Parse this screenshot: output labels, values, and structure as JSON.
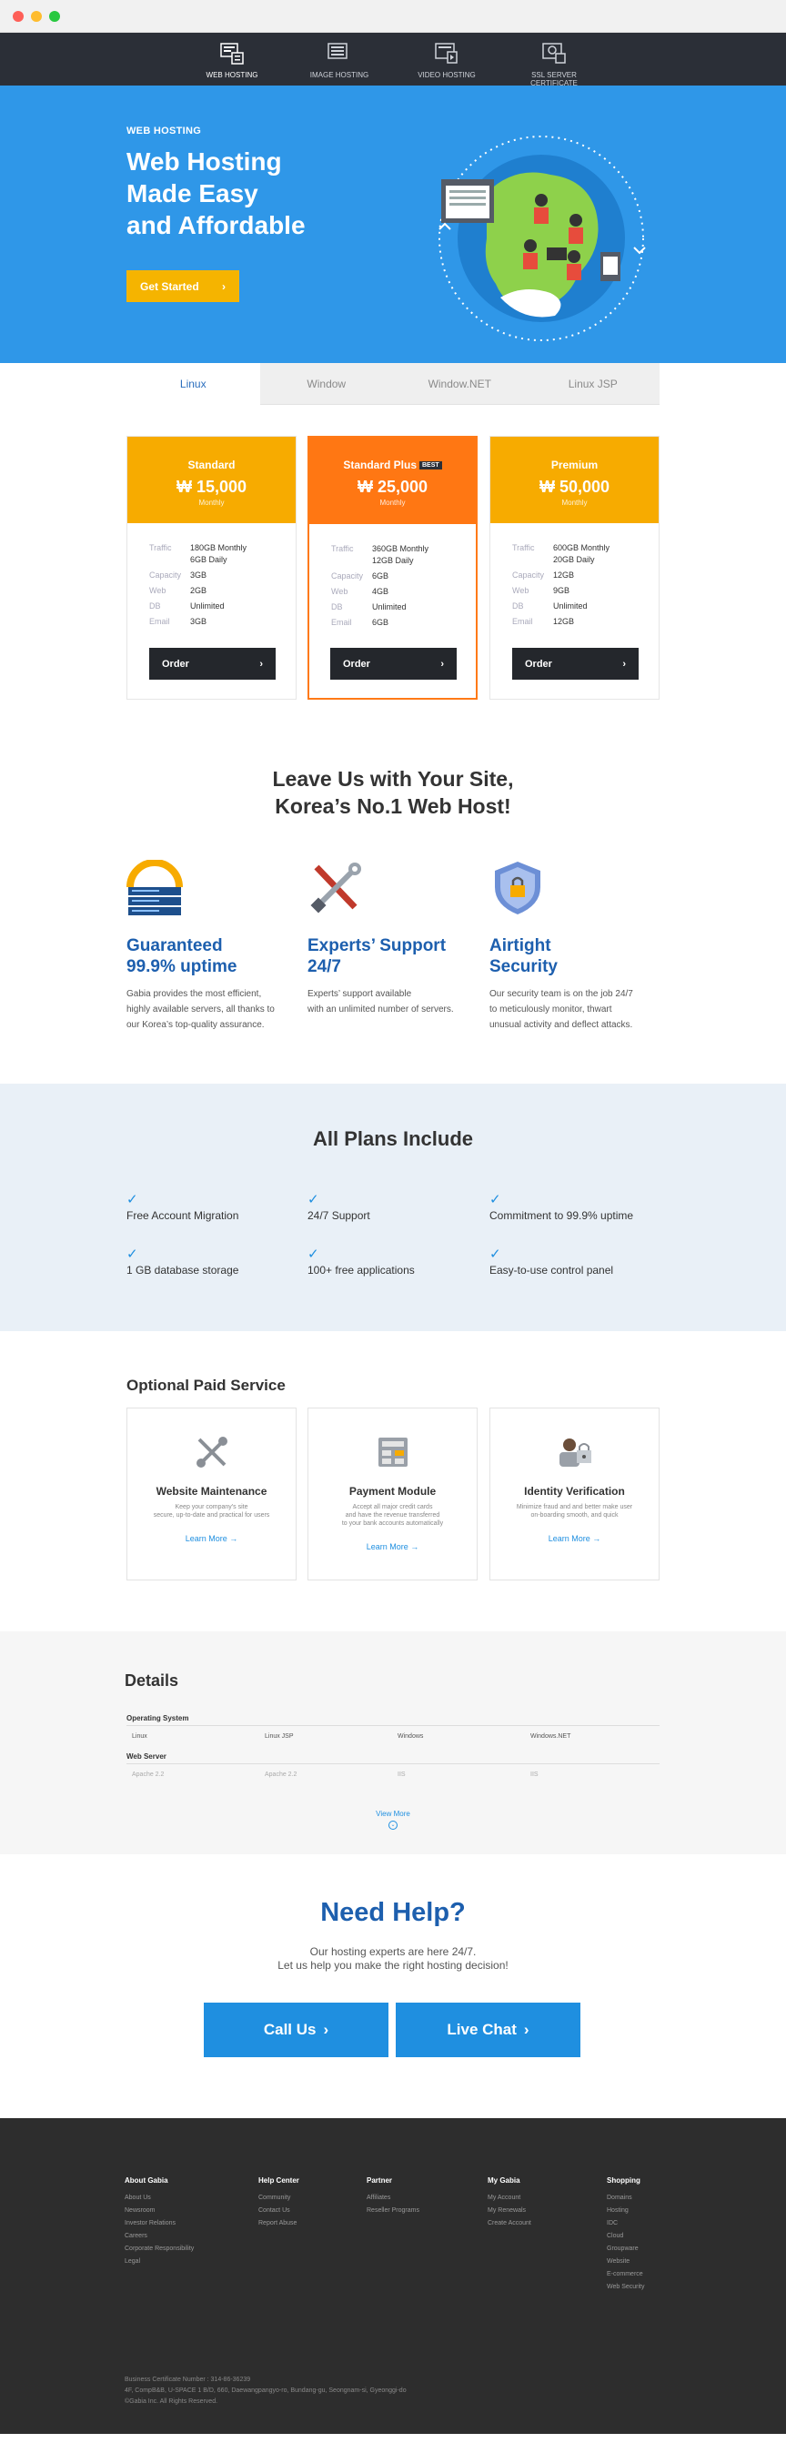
{
  "topnav": {
    "items": [
      {
        "label": "WEB HOSTING",
        "icon": "web-hosting-icon",
        "active": true
      },
      {
        "label": "IMAGE HOSTING",
        "icon": "image-hosting-icon",
        "active": false
      },
      {
        "label": "VIDEO HOSTING",
        "icon": "video-hosting-icon",
        "active": false
      },
      {
        "label": "SSL SERVER CERTIFICATE",
        "icon": "ssl-certificate-icon",
        "active": false
      }
    ]
  },
  "hero": {
    "eyebrow": "WEB HOSTING",
    "title": "Web Hosting\nMade Easy\nand Affordable",
    "cta": "Get Started"
  },
  "tabs": [
    "Linux",
    "Window",
    "Window.NET",
    "Linux JSP"
  ],
  "plans": [
    {
      "name": "Standard",
      "price": "₩ 15,000",
      "cycle": "Monthly",
      "color": "#f7ab00",
      "badge": "",
      "specs": [
        [
          "Traffic",
          "180GB Monthly\n6GB Daily"
        ],
        [
          "Capacity",
          "3GB"
        ],
        [
          "Web",
          "2GB"
        ],
        [
          "DB",
          "Unlimited"
        ],
        [
          "Email",
          "3GB"
        ]
      ],
      "order": "Order"
    },
    {
      "name": "Standard Plus",
      "price": "₩ 25,000",
      "cycle": "Monthly",
      "color": "#ff7713",
      "badge": "BEST",
      "specs": [
        [
          "Traffic",
          "360GB Monthly\n12GB Daily"
        ],
        [
          "Capacity",
          "6GB"
        ],
        [
          "Web",
          "4GB"
        ],
        [
          "DB",
          "Unlimited"
        ],
        [
          "Email",
          "6GB"
        ]
      ],
      "order": "Order"
    },
    {
      "name": "Premium",
      "price": "₩ 50,000",
      "cycle": "Monthly",
      "color": "#f7ab00",
      "badge": "",
      "specs": [
        [
          "Traffic",
          "600GB Monthly\n20GB Daily"
        ],
        [
          "Capacity",
          "12GB"
        ],
        [
          "Web",
          "9GB"
        ],
        [
          "DB",
          "Unlimited"
        ],
        [
          "Email",
          "12GB"
        ]
      ],
      "order": "Order"
    }
  ],
  "leave": "Leave Us with Your Site,\nKorea’s No.1 Web Host!",
  "features": [
    {
      "title": "Guaranteed\n99.9% uptime",
      "text": "Gabia provides the most efficient,\nhighly available servers, all thanks to\nour Korea’s top-quality assurance.",
      "icon": "uptime-server-icon",
      "badge": "99.9%"
    },
    {
      "title": "Experts’ Support\n24/7",
      "text": "Experts’ support available\nwith an unlimited number of servers.",
      "icon": "tools-icon"
    },
    {
      "title": "Airtight\nSecurity",
      "text": "Our security team is on the job 24/7\nto meticulously monitor, thwart\nunusual activity and deflect attacks.",
      "icon": "security-shield-icon"
    }
  ],
  "allplans": {
    "title": "All Plans Include",
    "items": [
      "Free Account Migration",
      "24/7 Support",
      "Commitment to 99.9% uptime",
      "1 GB database storage",
      "100+ free applications",
      "Easy-to-use control panel"
    ]
  },
  "optional": {
    "title": "Optional Paid Service",
    "cards": [
      {
        "name": "Website Maintenance",
        "desc": "Keep your company’s site\nsecure, up-to-date and practical for users",
        "more": "Learn More",
        "icon": "wrench-icon"
      },
      {
        "name": "Payment Module",
        "desc": "Accept all major credit cards\nand have the revenue transferred\nto your bank accounts automatically",
        "more": "Learn More",
        "icon": "calculator-icon"
      },
      {
        "name": "Identity Verification",
        "desc": "Minimize fraud and and better make user\non-boarding smooth, and quick",
        "more": "Learn More",
        "icon": "identity-lock-icon"
      }
    ]
  },
  "details": {
    "title": "Details",
    "os_label": "Operating System",
    "os": [
      "Linux",
      "Linux JSP",
      "Windows",
      "Windows.NET"
    ],
    "ws_label": "Web Server",
    "ws": [
      "Apache 2.2",
      "Apache 2.2",
      "IIS",
      "IIS"
    ],
    "more": "View More"
  },
  "help": {
    "title": "Need Help?",
    "sub": "Our hosting experts are here 24/7.\nLet us help you make the right hosting decision!",
    "call": "Call Us",
    "chat": "Live Chat"
  },
  "footer": {
    "cols": [
      {
        "head": "About Gabia",
        "items": [
          "About Us",
          "Newsroom",
          "Investor Relations",
          "Careers",
          "Corporate Responsibility",
          "Legal"
        ]
      },
      {
        "head": "Help Center",
        "items": [
          "Community",
          "Contact Us",
          "Report Abuse"
        ]
      },
      {
        "head": "Partner",
        "items": [
          "Affiliates",
          "Reseller Programs"
        ]
      },
      {
        "head": "My Gabia",
        "items": [
          "My Account",
          "My Renewals",
          "Create Account"
        ]
      },
      {
        "head": "Shopping",
        "items": [
          "Domains",
          "Hosting",
          "IDC",
          "Cloud",
          "Groupware",
          "Website",
          "E-commerce",
          "Web Security"
        ]
      }
    ],
    "copy": "Business Certificate Number : 314-86-36239\n4F, CompB&B, U-SPACE 1 B/D, 660, Daewangpangyo-ro, Bundang-gu, Seongnam-si, Gyeonggi-do\n©Gabia Inc. All Rights Reserved."
  }
}
